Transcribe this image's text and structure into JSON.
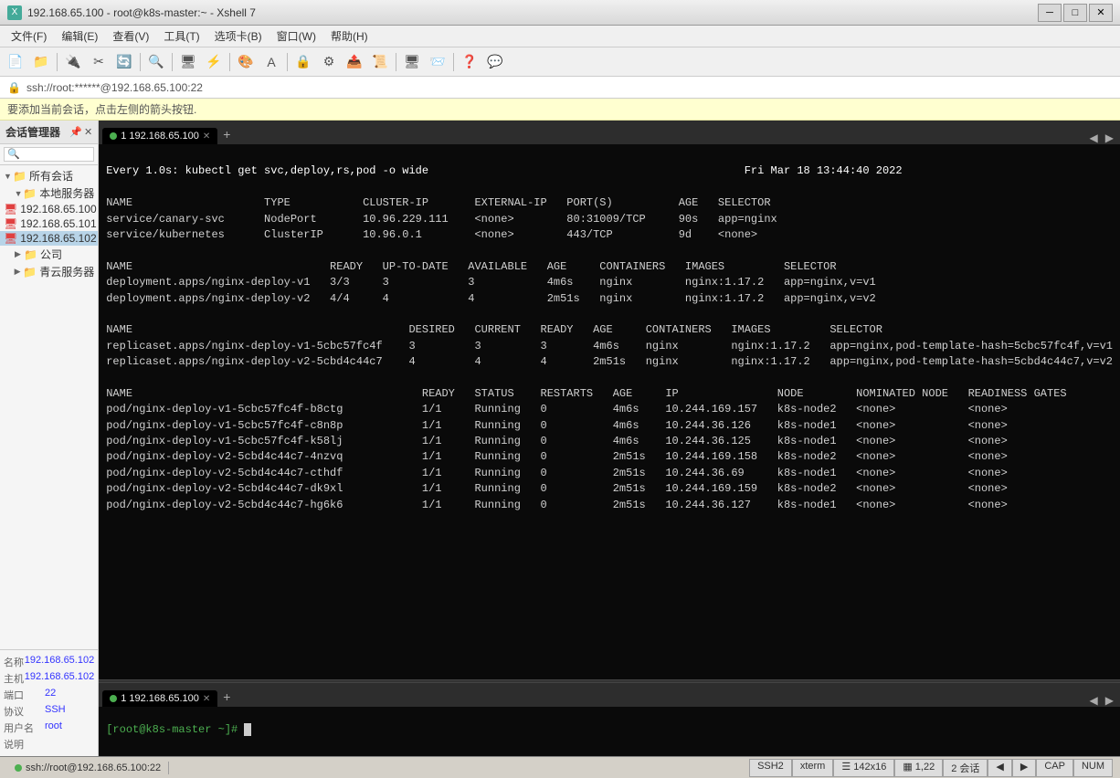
{
  "window": {
    "title": "192.168.65.100 - root@k8s-master:~ - Xshell 7",
    "icon": "🖥"
  },
  "menubar": {
    "items": [
      "文件(F)",
      "编辑(E)",
      "查看(V)",
      "工具(T)",
      "选项卡(B)",
      "窗口(W)",
      "帮助(H)"
    ]
  },
  "address_bar": {
    "text": "ssh://root:******@192.168.65.100:22"
  },
  "info_bar": {
    "text": "要添加当前会话，点击左侧的箭头按钮."
  },
  "sidebar": {
    "title": "会话管理器",
    "groups": [
      {
        "label": "所有会话",
        "level": 0,
        "type": "folder",
        "expanded": true
      },
      {
        "label": "本地服务器",
        "level": 1,
        "type": "folder",
        "expanded": true
      },
      {
        "label": "192.168.65.100",
        "level": 2,
        "type": "server-red"
      },
      {
        "label": "192.168.65.101",
        "level": 2,
        "type": "server-red"
      },
      {
        "label": "192.168.65.102",
        "level": 2,
        "type": "server-red",
        "selected": true
      },
      {
        "label": "公司",
        "level": 1,
        "type": "folder",
        "expanded": false
      },
      {
        "label": "青云服务器",
        "level": 1,
        "type": "folder",
        "expanded": false
      }
    ]
  },
  "properties": {
    "rows": [
      {
        "label": "名称",
        "value": "192.168.65.102"
      },
      {
        "label": "主机",
        "value": "192.168.65.102"
      },
      {
        "label": "端口",
        "value": "22"
      },
      {
        "label": "协议",
        "value": "SSH"
      },
      {
        "label": "用户名",
        "value": "root"
      },
      {
        "label": "说明",
        "value": ""
      }
    ]
  },
  "terminal": {
    "tabs": [
      {
        "label": "1 192.168.65.100",
        "active": true
      },
      {
        "label": "+",
        "is_add": true
      }
    ],
    "command_header": "Every 1.0s: kubectl get svc,deploy,rs,pod -o wide",
    "timestamp": "Fri Mar 18 13:44:40 2022",
    "content_lines": [
      "NAME                    TYPE           CLUSTER-IP       EXTERNAL-IP   PORT(S)          AGE   SELECTOR",
      "service/canary-svc      NodePort       10.96.229.111    <none>        80:31009/TCP     90s   app=nginx",
      "service/kubernetes      ClusterIP      10.96.0.1        <none>        443/TCP          9d    <none>",
      "",
      "NAME                              READY   UP-TO-DATE   AVAILABLE   AGE     CONTAINERS   IMAGES         SELECTOR",
      "deployment.apps/nginx-deploy-v1   3/3     3            3           4m6s    nginx        nginx:1.17.2   app=nginx,v=v1",
      "deployment.apps/nginx-deploy-v2   4/4     4            4           2m51s   nginx        nginx:1.17.2   app=nginx,v=v2",
      "",
      "NAME                                          DESIRED   CURRENT   READY   AGE     CONTAINERS   IMAGES         SELECTOR",
      "replicaset.apps/nginx-deploy-v1-5cbc57fc4f    3         3         3       4m6s    nginx        nginx:1.17.2   app=nginx,pod-template-hash=5cbc57fc4f,v=v1",
      "replicaset.apps/nginx-deploy-v2-5cbd4c44c7    4         4         4       2m51s   nginx        nginx:1.17.2   app=nginx,pod-template-hash=5cbd4c44c7,v=v2",
      "",
      "NAME                                            READY   STATUS    RESTARTS   AGE     IP               NODE        NOMINATED NODE   READINESS GATES",
      "pod/nginx-deploy-v1-5cbc57fc4f-b8ctg            1/1     Running   0          4m6s    10.244.169.157   k8s-node2   <none>           <none>",
      "pod/nginx-deploy-v1-5cbc57fc4f-c8n8p            1/1     Running   0          4m6s    10.244.36.126    k8s-node1   <none>           <none>",
      "pod/nginx-deploy-v1-5cbc57fc4f-k58lj            1/1     Running   0          4m6s    10.244.36.125    k8s-node1   <none>           <none>",
      "pod/nginx-deploy-v2-5cbd4c44c7-4nzvq            1/1     Running   0          2m51s   10.244.169.158   k8s-node2   <none>           <none>",
      "pod/nginx-deploy-v2-5cbd4c44c7-cthdf            1/1     Running   0          2m51s   10.244.36.69     k8s-node1   <none>           <none>",
      "pod/nginx-deploy-v2-5cbd4c44c7-dk9xl            1/1     Running   0          2m51s   10.244.169.159   k8s-node2   <none>           <none>",
      "pod/nginx-deploy-v2-5cbd4c44c7-hg6k6            1/1     Running   0          2m51s   10.244.36.127    k8s-node1   <none>           <none>"
    ]
  },
  "bottom_terminal": {
    "tabs": [
      {
        "label": "1 192.168.65.100",
        "active": true
      },
      {
        "label": "+",
        "is_add": true
      }
    ],
    "prompt": "[root@k8s-master ~]# "
  },
  "status_bar": {
    "left_text": "ssh://root@192.168.65.100:22",
    "segments": [
      "SSH2",
      "xterm",
      "142x16",
      "1,22",
      "2 会话",
      "CAP",
      "NUM"
    ]
  }
}
